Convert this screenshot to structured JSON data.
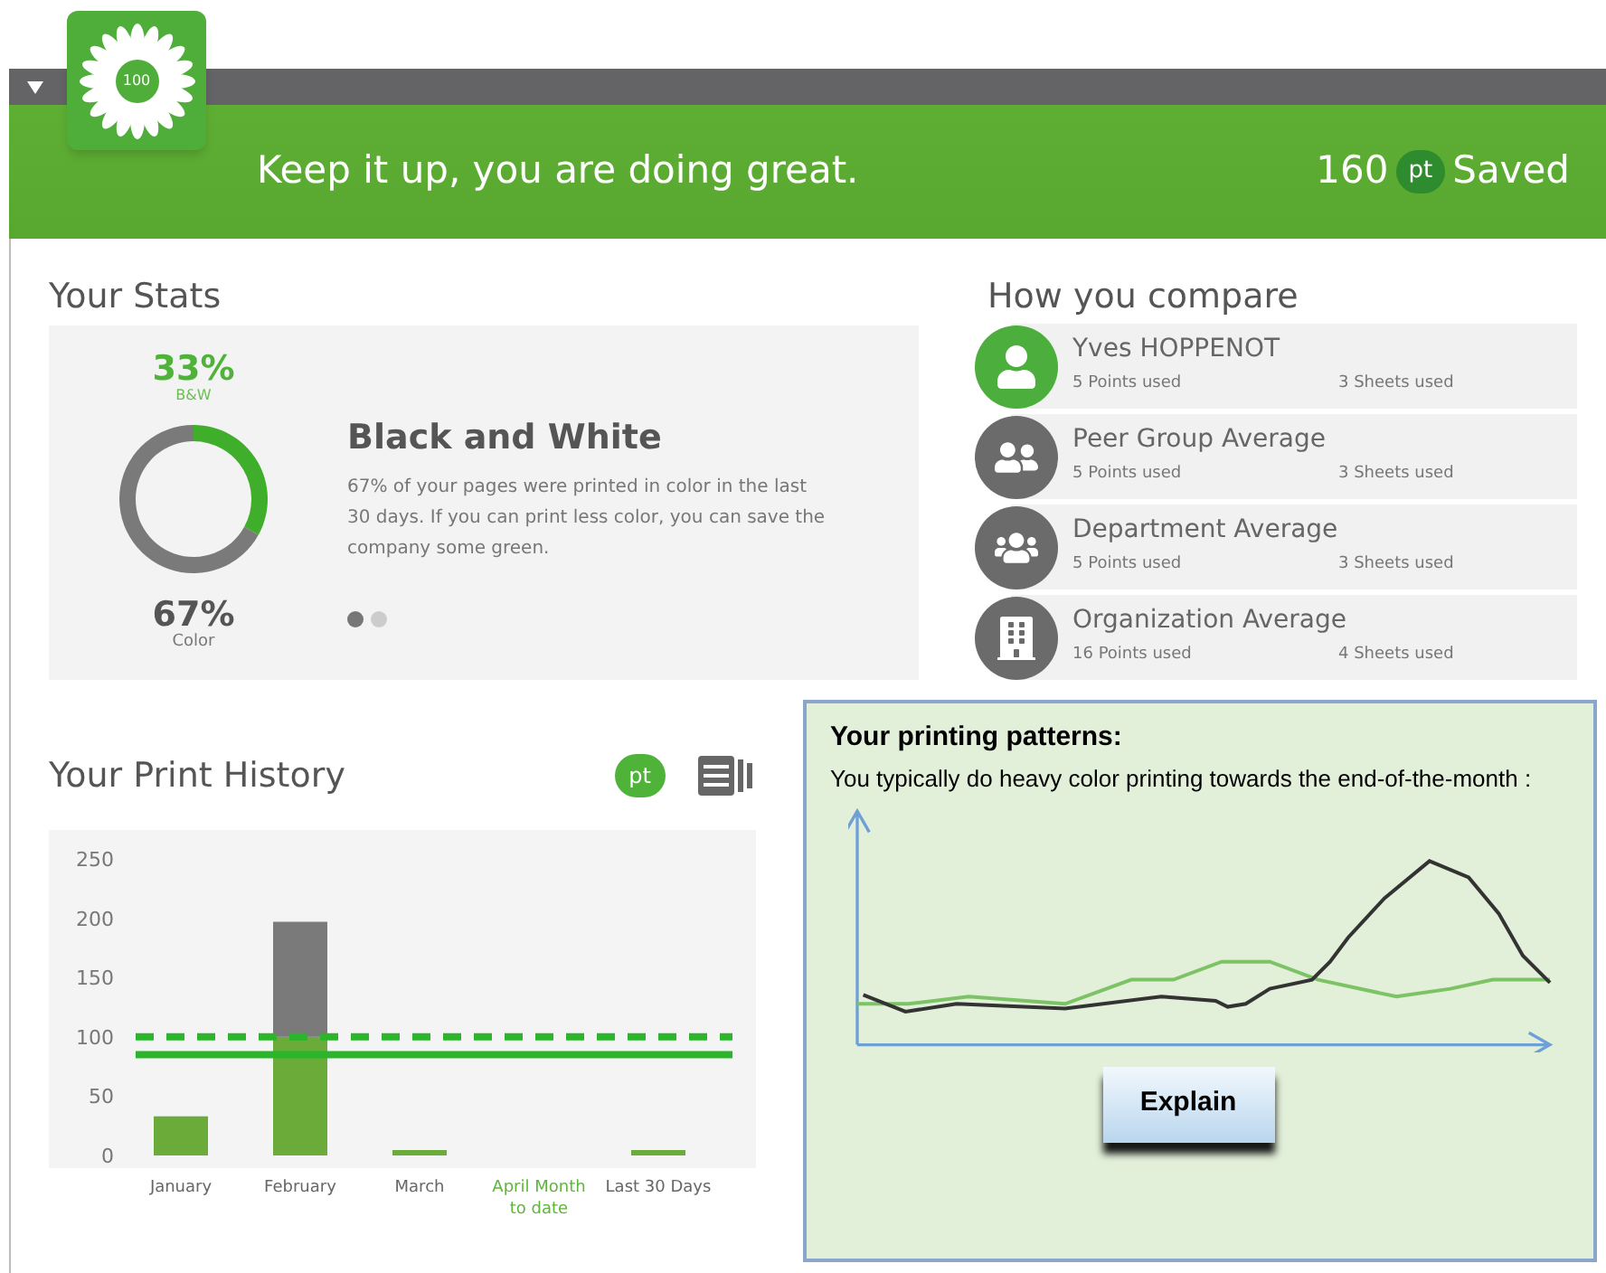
{
  "header": {
    "logo_text": "100",
    "message": "Keep it up, you are doing great.",
    "saved_value": "160",
    "saved_unit": "pt",
    "saved_label": "Saved"
  },
  "stats": {
    "title": "Your Stats",
    "bw_percent": "33%",
    "color_percent": "67%",
    "chart_data": {
      "type": "donut",
      "categories": [
        "B&W",
        "Color"
      ],
      "values": [
        33,
        67
      ]
    },
    "heading": "Black and White",
    "body": "67% of your pages were printed in color in the last 30 days. If you can print less color, you can save the company some green.",
    "pager": [
      {
        "selected": true
      },
      {
        "selected": false
      }
    ]
  },
  "compare": {
    "title": "How you compare",
    "rows": [
      {
        "kind": "person",
        "name": "Yves HOPPENOT",
        "points": "5 Points used",
        "sheets": "3 Sheets used",
        "color": "#4cae3c"
      },
      {
        "kind": "peers",
        "name": "Peer Group Average",
        "points": "5 Points used",
        "sheets": "3 Sheets used",
        "color": "#6b6b6b"
      },
      {
        "kind": "department",
        "name": "Department Average",
        "points": "5 Points used",
        "sheets": "3 Sheets used",
        "color": "#6b6b6b"
      },
      {
        "kind": "organization",
        "name": "Organization Average",
        "points": "16 Points used",
        "sheets": "4 Sheets used",
        "color": "#6b6b6b"
      }
    ]
  },
  "history": {
    "title": "Your Print History",
    "views": [
      {
        "kind": "points",
        "label": "pt",
        "selected": true
      },
      {
        "kind": "sheets",
        "selected": false
      }
    ],
    "period_selected": [
      false,
      false,
      false,
      true,
      false
    ],
    "chart_data": {
      "type": "bar",
      "categories": [
        "January",
        "February",
        "March",
        "April Month to date",
        "Last 30 Days"
      ],
      "stacked": true,
      "series": [
        {
          "color": "#6aab3a",
          "values": [
            33,
            100,
            3,
            0,
            3
          ]
        },
        {
          "color": "#7a7a7a",
          "values": [
            0,
            97,
            0,
            0,
            0
          ]
        }
      ],
      "ylim": [
        0,
        250
      ],
      "yticks": [
        0,
        50,
        100,
        150,
        200,
        250
      ],
      "ref_lines": [
        {
          "axis": "y",
          "value": 100,
          "color": "#2bb52b"
        },
        {
          "axis": "y",
          "value": 85,
          "color": "#2bb52b"
        }
      ]
    }
  },
  "patterns": {
    "title": "Your printing patterns:",
    "text": "You typically do heavy color printing towards the end-of-the-month :",
    "button": "Explain"
  }
}
